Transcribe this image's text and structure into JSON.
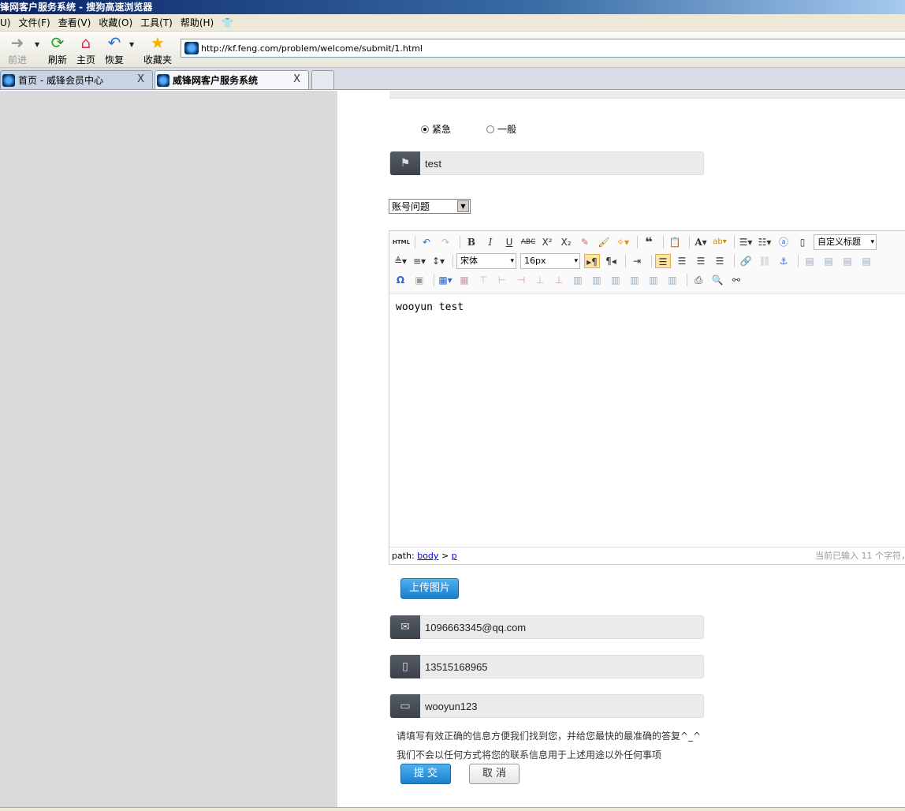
{
  "window": {
    "title": "锋网客户服务系统 - 搜狗高速浏览器"
  },
  "menu": {
    "items": [
      "U)",
      "文件(F)",
      "查看(V)",
      "收藏(O)",
      "工具(T)",
      "帮助(H)"
    ]
  },
  "toolbar": {
    "forward": "前进",
    "refresh": "刷新",
    "home": "主页",
    "restore": "恢复",
    "favorites": "收藏夹"
  },
  "address": {
    "url": "http://kf.feng.com/problem/welcome/submit/1.html"
  },
  "tabs": [
    {
      "label": "首页 - 威锋会员中心",
      "close": "X"
    },
    {
      "label": "威锋网客户服务系统",
      "close": "X"
    }
  ],
  "form": {
    "priority": {
      "options": [
        "紧急",
        "一般"
      ],
      "selected": "紧急"
    },
    "title_value": "test",
    "category": "账号问题",
    "email_value": "1096663345@qq.com",
    "phone_value": "13515168965",
    "id_value": "wooyun123",
    "upload_label": "上传图片",
    "note_line1": "请填写有效正确的信息方便我们找到您，并给您最快的最准确的答复^_^",
    "note_line2": "我们不会以任何方式将您的联系信息用于上述用途以外任何事项",
    "submit_label": "提 交",
    "cancel_label": "取 消"
  },
  "editor": {
    "font_family": "宋体",
    "font_size": "16px",
    "heading_select": "自定义标题",
    "html_label": "HTML",
    "body_text": "wooyun test",
    "path_label": "path:",
    "path_body": "body",
    "path_sep": ">",
    "path_p": "p",
    "char_count": "当前已输入 11 个字符，"
  }
}
